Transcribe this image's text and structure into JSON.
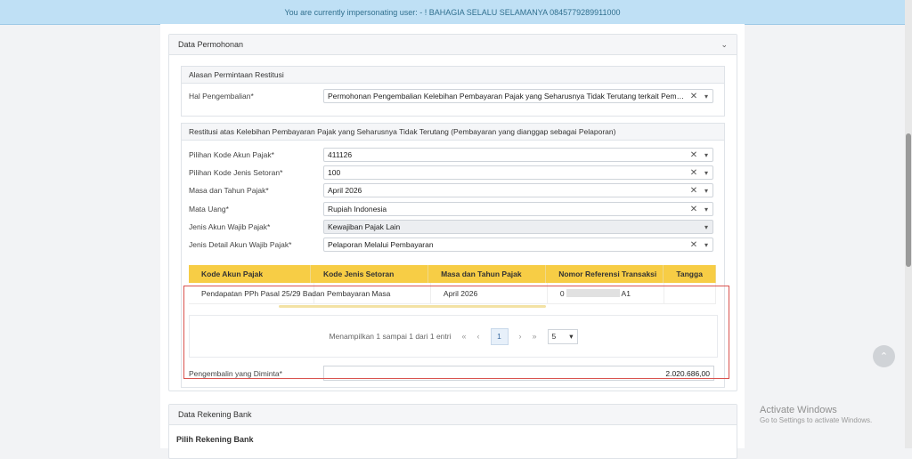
{
  "banner": {
    "text": "You are currently impersonating user: - ! BAHAGIA SELALU SELAMANYA 0845779289911000"
  },
  "panel_permohonan": {
    "title": "Data Permohonan"
  },
  "alasan": {
    "title": "Alasan Permintaan Restitusi",
    "hal_label": "Hal Pengembalian*",
    "hal_value": "Permohonan Pengembalian Kelebihan Pembayaran Pajak yang Seharusnya Tidak Terutang terkait Pembayaran"
  },
  "restitusi": {
    "title": "Restitusi atas Kelebihan Pembayaran Pajak yang Seharusnya Tidak Terutang (Pembayaran yang dianggap sebagai Pelaporan)",
    "fields": [
      {
        "label": "Pilihan Kode Akun Pajak*",
        "value": "411126"
      },
      {
        "label": "Pilihan Kode Jenis Setoran*",
        "value": "100"
      },
      {
        "label": "Masa dan Tahun Pajak*",
        "value": "April 2026"
      },
      {
        "label": "Mata Uang*",
        "value": "Rupiah Indonesia"
      },
      {
        "label": "Jenis Akun Wajib Pajak*",
        "value": "Kewajiban Pajak Lain"
      },
      {
        "label": "Jenis Detail Akun Wajib Pajak*",
        "value": "Pelaporan Melalui Pembayaran"
      }
    ]
  },
  "table": {
    "columns": [
      "Kode Akun Pajak",
      "Kode Jenis Setoran",
      "Masa dan Tahun Pajak",
      "Nomor Referensi Transaksi",
      "Tangga"
    ],
    "row": {
      "kode_akun": "Pendapatan PPh Pasal 25/29 Badan",
      "kode_setoran": "Pembayaran Masa",
      "masa": "April 2026",
      "ref_start": "0",
      "ref_end": "A1",
      "tanggal": ""
    }
  },
  "pager": {
    "info": "Menampilkan 1 sampai 1 dari 1 entri",
    "first": "«",
    "prev": "‹",
    "page": "1",
    "next": "›",
    "last": "»",
    "page_size": "5"
  },
  "pengembalian": {
    "label": "Pengembalin yang Diminta*",
    "value": "2.020.686,00"
  },
  "panel_bank": {
    "title": "Data Rekening Bank",
    "subtitle": "Pilih Rekening Bank"
  },
  "watermark": {
    "line1": "Activate Windows",
    "line2": "Go to Settings to activate Windows."
  },
  "colors": {
    "accent": "#f7cd45",
    "highlight_border": "#d9534f",
    "banner_bg": "#bfe0f5"
  }
}
